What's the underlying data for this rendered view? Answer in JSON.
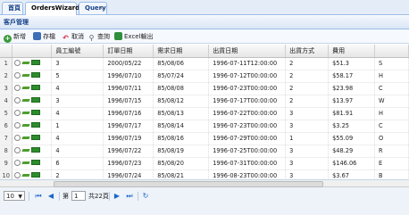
{
  "tabs": [
    {
      "label": "首頁",
      "active": false,
      "closable": false
    },
    {
      "label": "OrdersWizard",
      "active": true,
      "closable": true
    },
    {
      "label": "Query",
      "active": false,
      "closable": true
    }
  ],
  "panel": {
    "title": "客戶管理"
  },
  "toolbar": {
    "add": "新增",
    "save": "存檔",
    "cancel": "取消",
    "query": "查詢",
    "excel": "Excel輸出"
  },
  "grid": {
    "columns": [
      "",
      "",
      "員工編號",
      "訂單日期",
      "需求日期",
      "出貨日期",
      "出貨方式",
      "費用",
      ""
    ],
    "rows": [
      {
        "num": "1",
        "emp": "3",
        "order_date": "2000/05/22",
        "req_date": "85/08/06",
        "ship_date": "1996-07-11T12:00:00",
        "ship_via": "2",
        "freight": "$51.3",
        "extra": "S"
      },
      {
        "num": "2",
        "emp": "5",
        "order_date": "1996/07/10",
        "req_date": "85/07/24",
        "ship_date": "1996-07-12T00:00:00",
        "ship_via": "2",
        "freight": "$58.17",
        "extra": "H"
      },
      {
        "num": "3",
        "emp": "4",
        "order_date": "1996/07/11",
        "req_date": "85/08/08",
        "ship_date": "1996-07-23T00:00:00",
        "ship_via": "2",
        "freight": "$23.98",
        "extra": "C"
      },
      {
        "num": "4",
        "emp": "3",
        "order_date": "1996/07/15",
        "req_date": "85/08/12",
        "ship_date": "1996-07-17T00:00:00",
        "ship_via": "2",
        "freight": "$13.97",
        "extra": "W"
      },
      {
        "num": "5",
        "emp": "4",
        "order_date": "1996/07/16",
        "req_date": "85/08/13",
        "ship_date": "1996-07-22T00:00:00",
        "ship_via": "3",
        "freight": "$81.91",
        "extra": "H"
      },
      {
        "num": "6",
        "emp": "1",
        "order_date": "1996/07/17",
        "req_date": "85/08/14",
        "ship_date": "1996-07-23T00:00:00",
        "ship_via": "3",
        "freight": "$3.25",
        "extra": "C"
      },
      {
        "num": "7",
        "emp": "4",
        "order_date": "1996/07/19",
        "req_date": "85/08/16",
        "ship_date": "1996-07-29T00:00:00",
        "ship_via": "1",
        "freight": "$55.09",
        "extra": "O"
      },
      {
        "num": "8",
        "emp": "4",
        "order_date": "1996/07/22",
        "req_date": "85/08/19",
        "ship_date": "1996-07-25T00:00:00",
        "ship_via": "3",
        "freight": "$48.29",
        "extra": "R"
      },
      {
        "num": "9",
        "emp": "6",
        "order_date": "1996/07/23",
        "req_date": "85/08/20",
        "ship_date": "1996-07-31T00:00:00",
        "ship_via": "3",
        "freight": "$146.06",
        "extra": "E"
      },
      {
        "num": "10",
        "emp": "2",
        "order_date": "1996/07/24",
        "req_date": "85/08/21",
        "ship_date": "1996-08-23T00:00:00",
        "ship_via": "3",
        "freight": "$3.67",
        "extra": "B"
      }
    ]
  },
  "pager": {
    "page_size": "10",
    "page_label": "第",
    "page_value": "1",
    "total_label": "共22頁"
  },
  "colors": {
    "accent": "#15428b",
    "border": "#99bbe8",
    "header_bg": "#dae6f6"
  }
}
